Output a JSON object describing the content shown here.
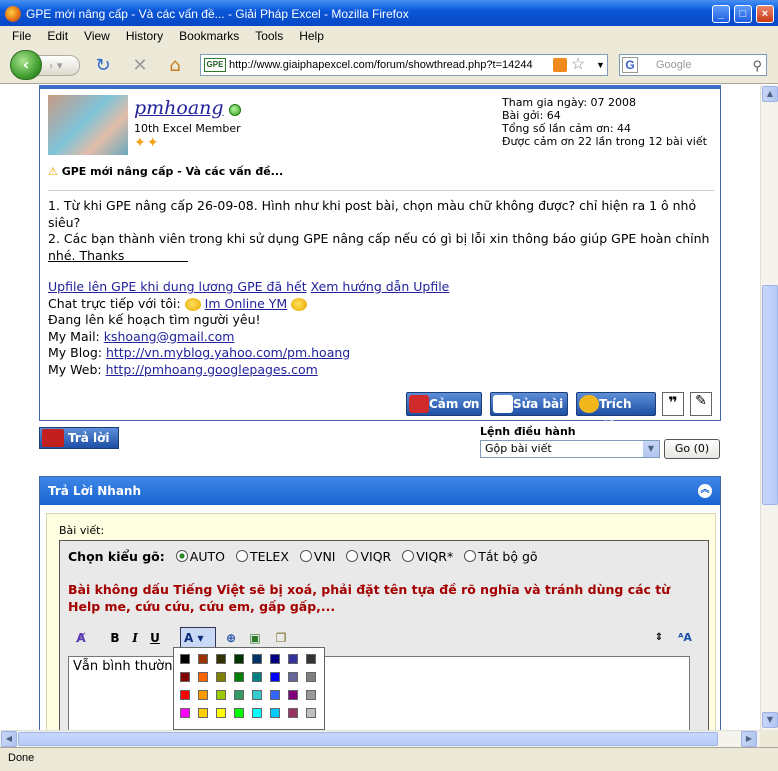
{
  "browser": {
    "window_title": "GPE mới nâng cấp - Và các vấn đề... - Giải Pháp Excel - Mozilla Firefox",
    "menu": [
      "File",
      "Edit",
      "View",
      "History",
      "Bookmarks",
      "Tools",
      "Help"
    ],
    "url": "http://www.giaiphapexcel.com/forum/showthread.php?t=14244",
    "favicon_text": "GPE",
    "search_placeholder": "Google",
    "status": "Done"
  },
  "post": {
    "username": "pmhoang",
    "rank": "10th Excel Member",
    "info": {
      "joined": "Tham gia ngày: 07 2008",
      "posts": "Bài gởi: 64",
      "thanks_given": "Tổng số lần cảm ơn: 44",
      "thanks_received": "Được cảm ơn 22 lần trong 12 bài viết"
    },
    "title": "GPE mới nâng cấp - Và các vấn đề...",
    "body_1": "1. Từ khi GPE nâng cấp 26-09-08. Hình như khi post bài, chọn màu chữ không được? chỉ hiện ra 1 ô nhỏ siêu?",
    "body_2": "2. Các bạn thành viên trong khi sử dụng GPE nâng cấp nếu có gì bị lỗi xin thông báo giúp GPE hoàn chỉnh nhé. Thanks",
    "sig": {
      "link1": "Upfile lên GPE khi dung lương GPE đã hết",
      "link2": "Xem hướng dẫn Upfile",
      "chat_label": "Chat trực tiếp với tôi:",
      "chat_link": "Im Online YM",
      "line3": "Đang lên kế hoạch tìm người yêu!",
      "mail_label": "My Mail:",
      "mail": "kshoang@gmail.com",
      "blog_label": "My Blog:",
      "blog": "http://vn.myblog.yahoo.com/pm.hoang",
      "web_label": "My Web:",
      "web": "http://pmhoang.googlepages.com"
    },
    "buttons": {
      "thanks": "Cảm ơn",
      "edit": "Sửa bài",
      "quote": "Trích dẫn"
    }
  },
  "thread_actions": {
    "reply": "Trả lời",
    "mod_label": "Lệnh điều hành",
    "mod_select": "Gộp bài viết",
    "go": "Go (0)"
  },
  "quick_reply": {
    "header": "Trả Lời Nhanh",
    "post_label": "Bài viết:",
    "mode_label": "Chọn kiểu gõ:",
    "modes": [
      "AUTO",
      "TELEX",
      "VNI",
      "VIQR",
      "VIQR*",
      "Tắt bộ gõ"
    ],
    "selected_mode": "AUTO",
    "warning": "Bài không dấu Tiếng Việt sẽ bị xoá, phải đặt tên tựa đề rõ nghĩa và tránh dùng các từ Help me, cứu cứu, cứu em, gấp gấp,...",
    "textarea_value": "Vẫn bình thườn"
  },
  "colors": {
    "title_bar": "#0a56d8",
    "link": "#22229c",
    "warning_text": "#a40000",
    "palette": [
      [
        "#000000",
        "#993300",
        "#333300",
        "#003300",
        "#003366",
        "#000080",
        "#333399",
        "#333333"
      ],
      [
        "#800000",
        "#FF6600",
        "#808000",
        "#008000",
        "#008080",
        "#0000FF",
        "#666699",
        "#808080"
      ],
      [
        "#FF0000",
        "#FF9900",
        "#99CC00",
        "#339966",
        "#33CCCC",
        "#3366FF",
        "#800080",
        "#999999"
      ],
      [
        "#FF00FF",
        "#FFCC00",
        "#FFFF00",
        "#00FF00",
        "#00FFFF",
        "#00CCFF",
        "#993366",
        "#C0C0C0"
      ]
    ]
  }
}
